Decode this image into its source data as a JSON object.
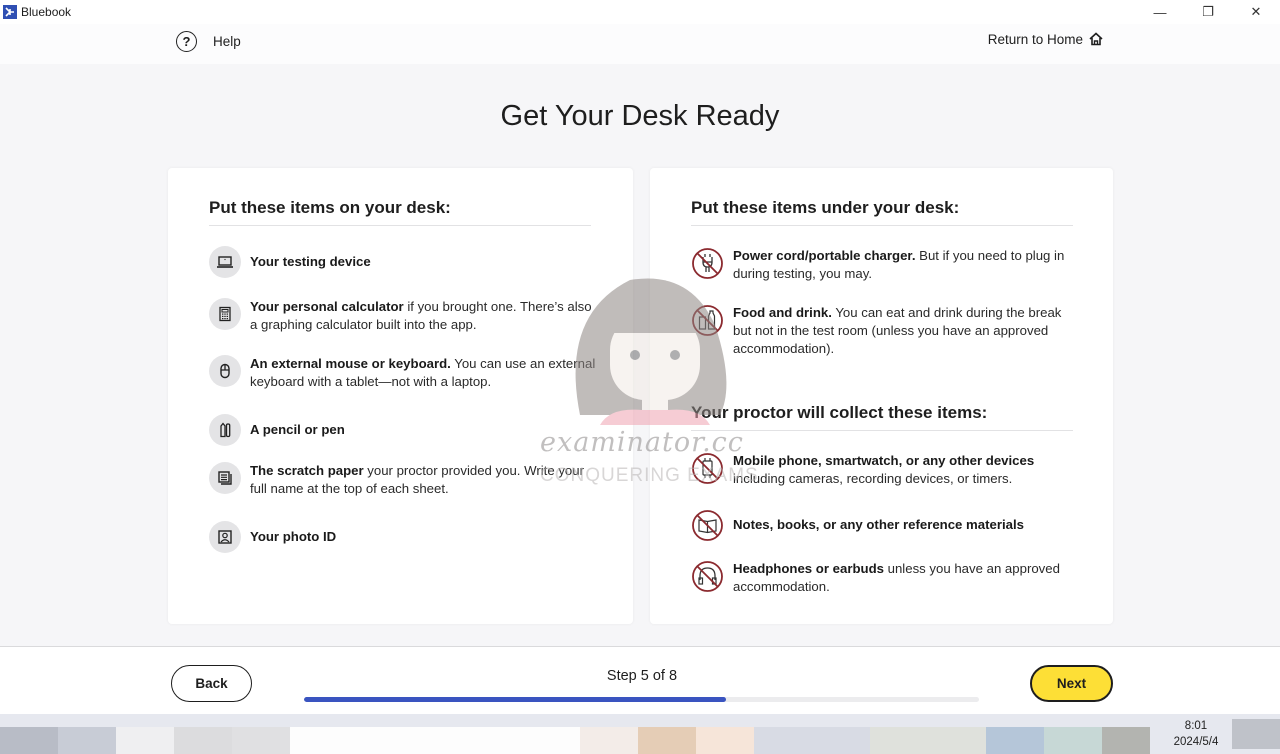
{
  "window": {
    "app_name": "Bluebook",
    "controls": {
      "minimize": "—",
      "restore": "❐",
      "close": "✕"
    }
  },
  "header": {
    "help_label": "Help",
    "help_icon": "question-circle-icon",
    "home_label": "Return to Home",
    "home_icon": "home-icon"
  },
  "page": {
    "title": "Get Your Desk Ready"
  },
  "on_desk": {
    "heading": "Put these items on your desk:",
    "items": [
      {
        "icon": "laptop-icon",
        "bold": "Your testing device",
        "text": ""
      },
      {
        "icon": "calculator-icon",
        "bold": "Your personal calculator",
        "text": " if you brought one. There’s also a graphing calculator built into the app."
      },
      {
        "icon": "mouse-icon",
        "bold": "An external mouse or keyboard.",
        "text": " You can use an external keyboard with a tablet—not with a laptop."
      },
      {
        "icon": "pencil-pen-icon",
        "bold": "A pencil or pen",
        "text": ""
      },
      {
        "icon": "scratch-paper-icon",
        "bold": "The scratch paper",
        "text": " your proctor provided you. Write your full name at the top of each sheet."
      },
      {
        "icon": "photo-id-icon",
        "bold": "Your photo ID",
        "text": ""
      }
    ]
  },
  "under_desk": {
    "heading": "Put these items under your desk:",
    "items": [
      {
        "icon": "no-power-plug-icon",
        "bold": "Power cord/portable charger.",
        "text": " But if you need to plug in during testing, you may."
      },
      {
        "icon": "no-food-drink-icon",
        "bold": "Food and drink.",
        "text": " You can eat and drink during the break but not in the test room (unless you have an approved accommodation)."
      }
    ]
  },
  "collect": {
    "heading": "Your proctor will collect these items:",
    "items": [
      {
        "icon": "no-devices-icon",
        "bold": "Mobile phone, smartwatch, or any other devices",
        "text": " including cameras, recording devices, or timers."
      },
      {
        "icon": "no-books-icon",
        "bold": "Notes, books, or any other reference materials",
        "text": ""
      },
      {
        "icon": "no-headphones-icon",
        "bold": "Headphones or earbuds",
        "text": " unless you have an approved accommodation."
      }
    ]
  },
  "footer": {
    "back_label": "Back",
    "next_label": "Next",
    "step_label": "Step 5 of 8",
    "current_step": 5,
    "total_steps": 8,
    "progress_fraction": 0.625
  },
  "colors": {
    "accent_blue": "#3a54c0",
    "next_yellow": "#fddf36",
    "ban_red": "#8b2a2f"
  },
  "taskbar": {
    "time": "8:01",
    "date": "2024/5/4"
  },
  "watermark": {
    "line1": "examinator.cc",
    "line2": "CONQUERING EXAMS"
  }
}
